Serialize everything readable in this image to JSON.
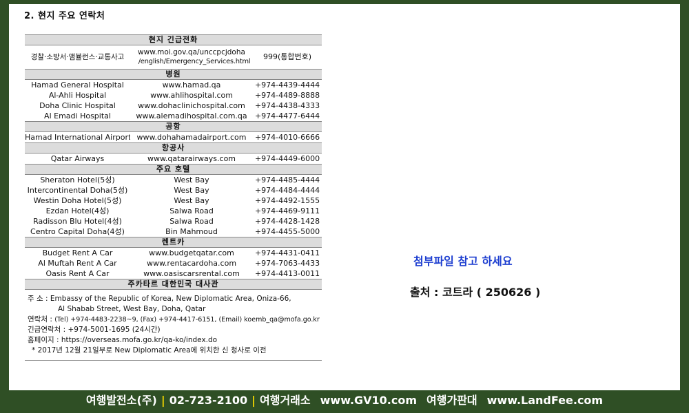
{
  "heading": "2. 현지 주요 연락처",
  "emergency": {
    "section": "현지 긴급전화",
    "name": "경찰·소방서·앰뷸런스·교통사고",
    "url_line1": "www.moi.gov.qa/unccpcjdoha",
    "url_line2": "/english/Emergency_Services.html",
    "phone": "999(통합번호)"
  },
  "hospitals": {
    "section": "병원",
    "rows": [
      {
        "name": "Hamad General Hospital",
        "url": "www.hamad.qa",
        "phone": "+974-4439-4444"
      },
      {
        "name": "Al-Ahli Hospital",
        "url": "www.ahlihospital.com",
        "phone": "+974-4489-8888"
      },
      {
        "name": "Doha Clinic Hospital",
        "url": "www.dohaclinichospital.com",
        "phone": "+974-4438-4333"
      },
      {
        "name": "Al Emadi Hospital",
        "url": "www.alemadihospital.com.qa",
        "phone": "+974-4477-6444"
      }
    ]
  },
  "airport": {
    "section": "공항",
    "rows": [
      {
        "name": "Hamad International Airport",
        "url": "www.dohahamadairport.com",
        "phone": "+974-4010-6666"
      }
    ]
  },
  "airline": {
    "section": "항공사",
    "rows": [
      {
        "name": "Qatar Airways",
        "url": "www.qatarairways.com",
        "phone": "+974-4449-6000"
      }
    ]
  },
  "hotels": {
    "section": "주요 호텔",
    "rows": [
      {
        "name": "Sheraton Hotel(5성)",
        "url": "West Bay",
        "phone": "+974-4485-4444"
      },
      {
        "name": "Intercontinental Doha(5성)",
        "url": "West Bay",
        "phone": "+974-4484-4444"
      },
      {
        "name": "Westin Doha Hotel(5성)",
        "url": "West Bay",
        "phone": "+974-4492-1555"
      },
      {
        "name": "Ezdan Hotel(4성)",
        "url": "Salwa Road",
        "phone": "+974-4469-9111"
      },
      {
        "name": "Radisson Blu Hotel(4성)",
        "url": "Salwa Road",
        "phone": "+974-4428-1428"
      },
      {
        "name": "Centro Capital Doha(4성)",
        "url": "Bin Mahmoud",
        "phone": "+974-4455-5000"
      }
    ]
  },
  "rentals": {
    "section": "렌트카",
    "rows": [
      {
        "name": "Budget Rent A Car",
        "url": "www.budgetqatar.com",
        "phone": "+974-4431-0411"
      },
      {
        "name": "Al Muftah Rent A Car",
        "url": "www.rentacardoha.com",
        "phone": "+974-7063-4433"
      },
      {
        "name": "Oasis Rent A Car",
        "url": "www.oasiscarsrental.com",
        "phone": "+974-4413-0011"
      }
    ]
  },
  "embassy": {
    "section": "주카타르 대한민국 대사관",
    "address_line1": "주 소 : Embassy of the Republic of Korea, New Diplomatic Area, Oniza-66,",
    "address_line2": "Al Shabab Street, West Bay, Doha, Qatar",
    "contact_label": "연락처 : ",
    "contact_value": "(Tel) +974-4483-2238~9,  (Fax) +974-4417-6151, (Email) koemb_qa@mofa.go.kr",
    "emergency_contact": "긴급연락처 : +974-5001-1695 (24시간)",
    "homepage": "홈페이지 : https://overseas.mofa.go.kr/qa-ko/index.do",
    "note": "* 2017년 12월 21일부로 New Diplomatic Area에 위치한 신 청사로 이전"
  },
  "attachment_note": "첨부파일 참고 하세요",
  "source_note": "출처 : 코트라 ( 250626 )",
  "footer": {
    "company": "여행발전소(주)",
    "phone": "02-723-2100",
    "exchange_label": "여행거래소",
    "exchange_url": "www.GV10.com",
    "price_label": "여행가판대",
    "price_url": "www.LandFee.com",
    "separator": "|"
  }
}
